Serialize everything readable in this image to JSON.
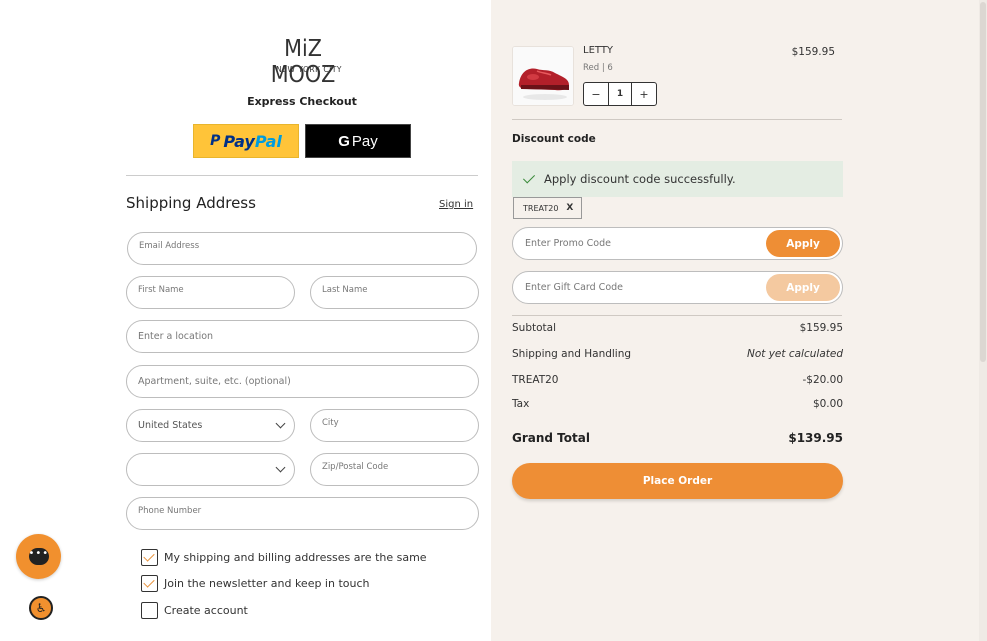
{
  "brand": {
    "logo_line1": "MiZ MOOZ",
    "logo_line2": "NEW YORK CITY"
  },
  "express": {
    "title": "Express Checkout",
    "paypal_p": "P",
    "paypal_label_a": "Pay",
    "paypal_label_b": "Pal",
    "gpay_g": "G",
    "gpay_label": "Pay"
  },
  "shipping": {
    "title": "Shipping Address",
    "sign_in": "Sign in",
    "email_placeholder": "Email Address",
    "first_name_placeholder": "First Name",
    "last_name_placeholder": "Last Name",
    "location_placeholder": "Enter a location",
    "apt_placeholder": "Apartment, suite, etc. (optional)",
    "country_value": "United States",
    "city_placeholder": "City",
    "state_value": "",
    "zip_placeholder": "Zip/Postal Code",
    "phone_placeholder": "Phone Number"
  },
  "checks": [
    {
      "label": "My shipping and billing addresses are the same",
      "checked": true
    },
    {
      "label": "Join the newsletter and keep in touch",
      "checked": true
    },
    {
      "label": "Create account",
      "checked": false
    }
  ],
  "widgets": {
    "chat_dots": "•••",
    "a11y_symbol": "♿"
  },
  "cart": {
    "item": {
      "name": "LETTY",
      "variant": "Red  |  6",
      "price": "$159.95",
      "quantity": "1",
      "minus": "−",
      "plus": "+"
    }
  },
  "discount": {
    "title": "Discount code",
    "success_message": "Apply discount code successfully.",
    "applied_code": "TREAT20",
    "remove_symbol": "X",
    "promo_placeholder": "Enter Promo Code",
    "promo_apply": "Apply",
    "gift_placeholder": "Enter Gift Card Code",
    "gift_apply": "Apply"
  },
  "summary": {
    "subtotal_label": "Subtotal",
    "subtotal_value": "$159.95",
    "shipping_label": "Shipping and Handling",
    "shipping_value": "Not yet calculated",
    "discount_label": "TREAT20",
    "discount_value": "-$20.00",
    "tax_label": "Tax",
    "tax_value": "$0.00",
    "total_label": "Grand Total",
    "total_value": "$139.95"
  },
  "place_order": "Place Order",
  "colors": {
    "accent": "#ee8e35",
    "accent_disabled": "#f4c9a0",
    "panel_bg": "#f6f1ec",
    "success_bg": "#e4ede3",
    "paypal_yellow": "#ffc439",
    "paypal_blue": "#003087"
  }
}
